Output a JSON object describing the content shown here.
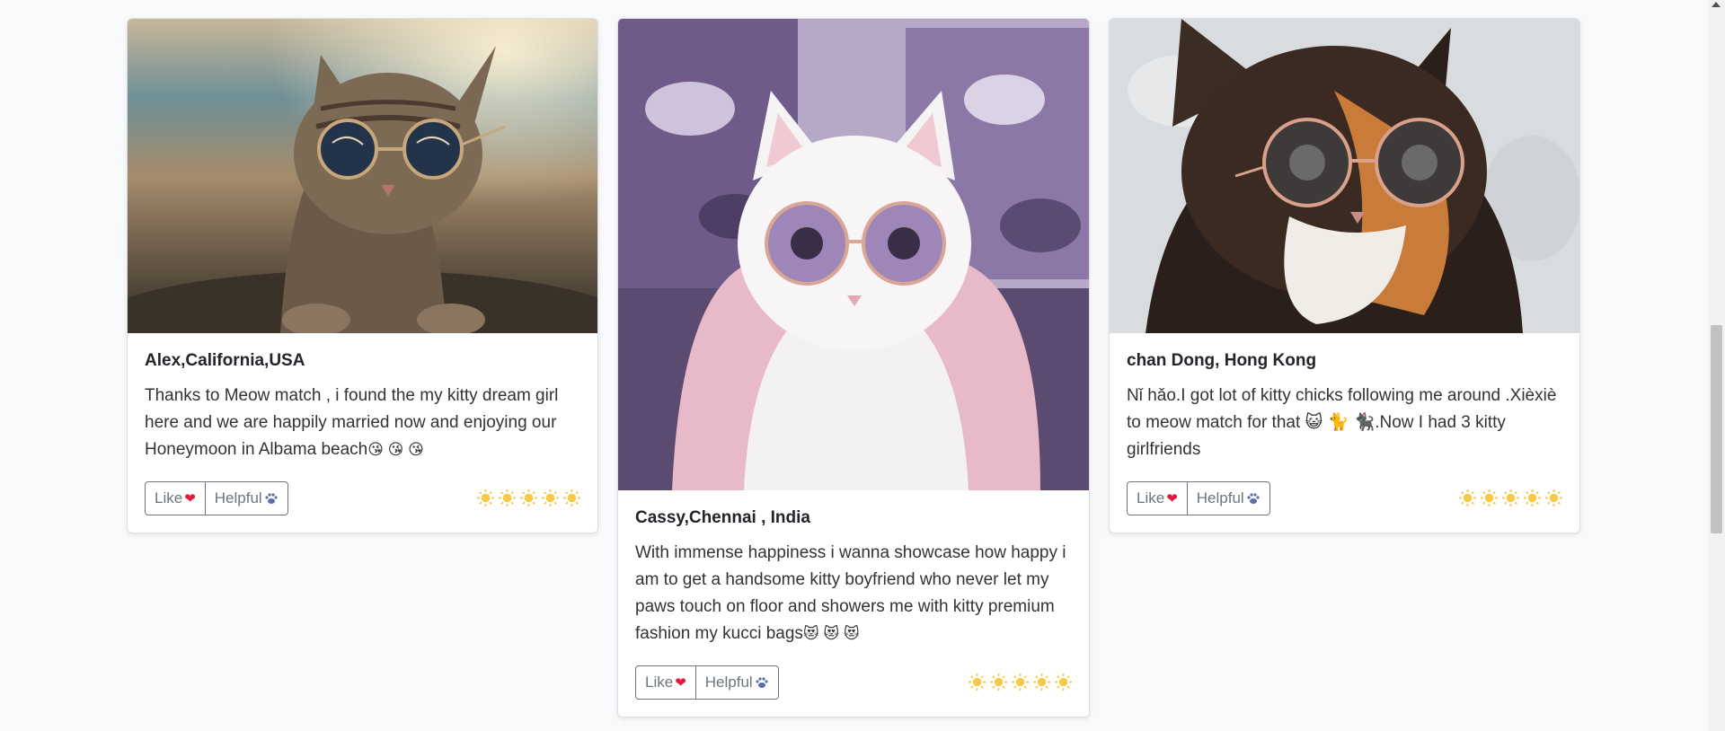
{
  "reviews": [
    {
      "author": "Alex,California,USA",
      "text": "Thanks to Meow match , i found the my kitty dream girl here and we are happily married now and enjoying our Honeymoon in Albama beach",
      "emojis": "😘 😘 😘",
      "like_label": "Like",
      "helpful_label": "Helpful",
      "rating": 5,
      "image": "tabby-cat-with-sunglasses-on-beach"
    },
    {
      "author": "Cassy,Chennai , India",
      "text": "With immense happiness i wanna showcase how happy i am to get a handsome kitty boyfriend who never let my paws touch on floor and showers me with kitty premium fashion my kucci bags",
      "emojis": "😻 😻 😻",
      "like_label": "Like",
      "helpful_label": "Helpful",
      "rating": 5,
      "image": "white-cat-with-round-purple-glasses-in-pink-robe"
    },
    {
      "author": "chan Dong, Hong Kong",
      "text": "Nǐ hǎo.I got lot of kitty chicks following me around .Xièxiè to meow match for that 😺 🐈 🐈‍⬛.Now I had 3 kitty girlfriends",
      "emojis": "",
      "like_label": "Like",
      "helpful_label": "Helpful",
      "rating": 5,
      "image": "calico-cat-with-round-sunglasses"
    }
  ],
  "colors": {
    "page_bg": "#f8f9fa",
    "card_border": "#dde0e3",
    "button_border": "#6c757d",
    "heart": "#e01b3c",
    "star": "#f7c948"
  }
}
